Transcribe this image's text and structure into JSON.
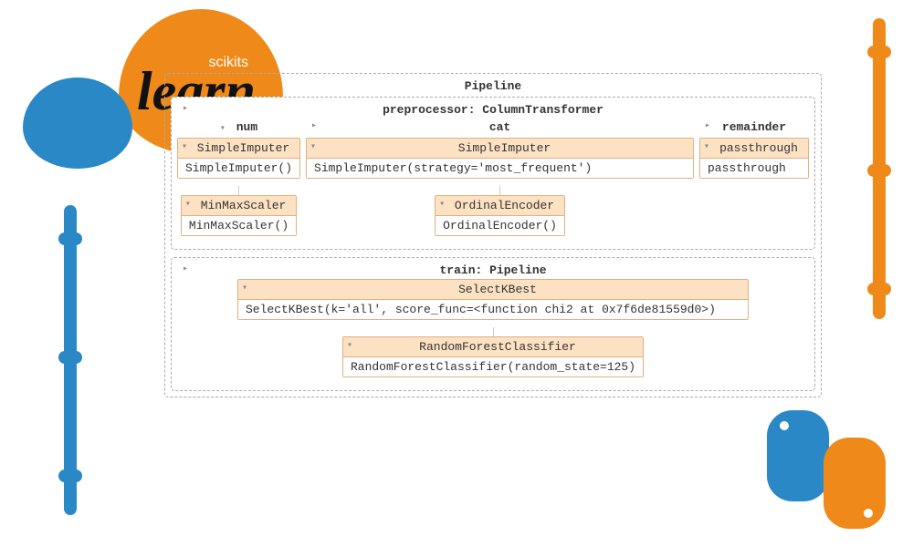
{
  "logo": {
    "top": "scikits",
    "main": "learn"
  },
  "diagram": {
    "title": "Pipeline",
    "preprocessor": {
      "title": "preprocessor: ColumnTransformer",
      "columns": {
        "num": {
          "label": "num",
          "steps": [
            {
              "name": "SimpleImputer",
              "repr": "SimpleImputer()"
            },
            {
              "name": "MinMaxScaler",
              "repr": "MinMaxScaler()"
            }
          ]
        },
        "cat": {
          "label": "cat",
          "steps": [
            {
              "name": "SimpleImputer",
              "repr": "SimpleImputer(strategy='most_frequent')"
            },
            {
              "name": "OrdinalEncoder",
              "repr": "OrdinalEncoder()"
            }
          ]
        },
        "remainder": {
          "label": "remainder",
          "steps": [
            {
              "name": "passthrough",
              "repr": "passthrough"
            }
          ]
        }
      }
    },
    "train": {
      "title": "train: Pipeline",
      "steps": [
        {
          "name": "SelectKBest",
          "repr": "SelectKBest(k='all', score_func=<function chi2 at 0x7f6de81559d0>)"
        },
        {
          "name": "RandomForestClassifier",
          "repr": "RandomForestClassifier(random_state=125)"
        }
      ]
    }
  }
}
